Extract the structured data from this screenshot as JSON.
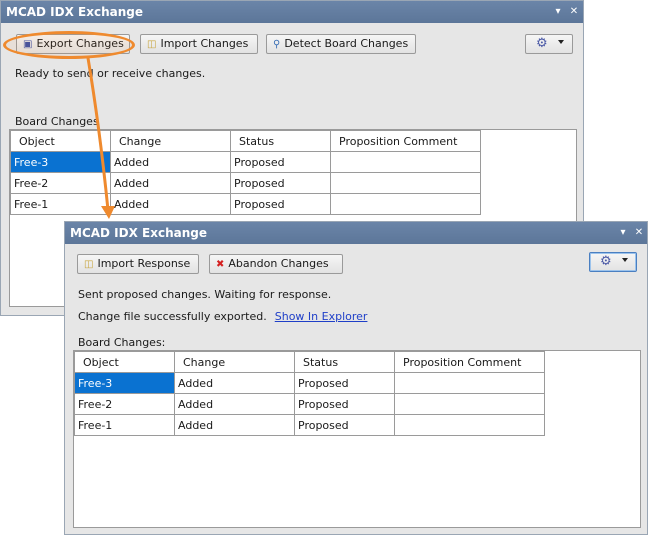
{
  "back_panel": {
    "title": "MCAD IDX Exchange",
    "pin_icon": "▾",
    "close_icon": "✕",
    "buttons": [
      {
        "label": "Export Changes",
        "icon": "save-icon"
      },
      {
        "label": "Import Changes",
        "icon": "folder-open-icon"
      },
      {
        "label": "Detect Board Changes",
        "icon": "magnifier-icon"
      }
    ],
    "status": "Ready to send or receive changes.",
    "section_label": "Board Changes",
    "table": {
      "headers": [
        "Object",
        "Change",
        "Status",
        "Proposition Comment"
      ],
      "rows": [
        [
          "Free-3",
          "Added",
          "Proposed",
          ""
        ],
        [
          "Free-2",
          "Added",
          "Proposed",
          ""
        ],
        [
          "Free-1",
          "Added",
          "Proposed",
          ""
        ]
      ],
      "selected_row": 0
    }
  },
  "front_panel": {
    "title": "MCAD IDX Exchange",
    "pin_icon": "▾",
    "close_icon": "✕",
    "buttons": [
      {
        "label": "Import Response",
        "icon": "folder-open-icon"
      },
      {
        "label": "Abandon Changes",
        "icon": "red-x-icon"
      }
    ],
    "status_line1": "Sent proposed changes. Waiting for response.",
    "status_line2": "Change file successfully exported.",
    "link": "Show In Explorer",
    "section_label": "Board Changes:",
    "table": {
      "headers": [
        "Object",
        "Change",
        "Status",
        "Proposition Comment"
      ],
      "rows": [
        [
          "Free-3",
          "Added",
          "Proposed",
          ""
        ],
        [
          "Free-2",
          "Added",
          "Proposed",
          ""
        ],
        [
          "Free-1",
          "Added",
          "Proposed",
          ""
        ]
      ],
      "selected_row": 0
    }
  },
  "colors": {
    "titlebar": "#5c7699",
    "selection": "#0a72d1",
    "highlight": "#ef8a2e",
    "link": "#1f3fc8"
  }
}
